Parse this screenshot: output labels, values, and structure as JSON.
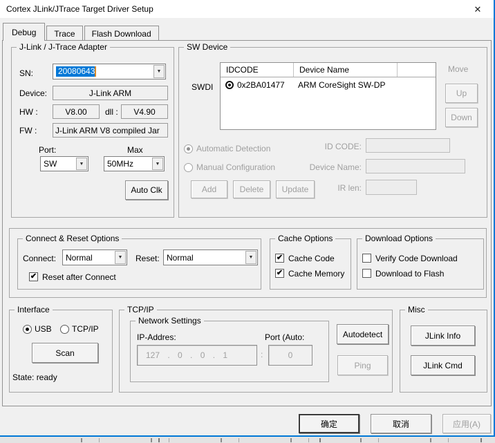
{
  "icons": {
    "close": "✕",
    "dropdown": "▼",
    "check": "✔"
  },
  "window": {
    "title": "Cortex JLink/JTrace Target Driver Setup"
  },
  "tabs": [
    {
      "label": "Debug",
      "active": true
    },
    {
      "label": "Trace",
      "active": false
    },
    {
      "label": "Flash Download",
      "active": false
    }
  ],
  "adapter": {
    "title": "J-Link / J-Trace Adapter",
    "sn_label": "SN:",
    "sn_value": "20080643",
    "device_label": "Device:",
    "device_value": "J-Link ARM",
    "hw_label": "HW :",
    "hw_value": "V8.00",
    "dll_label": "dll :",
    "dll_value": "V4.90",
    "fw_label": "FW :",
    "fw_value": "J-Link ARM V8 compiled Jar",
    "port_label": "Port:",
    "port_value": "SW",
    "max_label": "Max",
    "max_value": "50MHz",
    "auto_clk_label": "Auto Clk"
  },
  "sw_device": {
    "title": "SW Device",
    "swdio_label": "SWDI",
    "table": {
      "columns": [
        "IDCODE",
        "Device Name",
        ""
      ],
      "rows": [
        {
          "idcode": "0x2BA01477",
          "device_name": "ARM CoreSight SW-DP",
          "selected": true
        }
      ]
    },
    "move_label": "Move",
    "up_label": "Up",
    "down_label": "Down",
    "automatic_detection_label": "Automatic Detection",
    "automatic_detection_selected": true,
    "manual_configuration_label": "Manual Configuration",
    "add_label": "Add",
    "delete_label": "Delete",
    "update_label": "Update",
    "id_code_label": "ID CODE:",
    "id_code_value": "",
    "device_name_label": "Device Name:",
    "device_name_value": "",
    "ir_len_label": "IR len:",
    "ir_len_value": ""
  },
  "connect_reset": {
    "title": "Connect & Reset Options",
    "connect_label": "Connect:",
    "connect_value": "Normal",
    "reset_label": "Reset:",
    "reset_value": "Normal",
    "reset_after_connect_label": "Reset after Connect",
    "reset_after_connect_checked": true
  },
  "cache_options": {
    "title": "Cache Options",
    "items": [
      {
        "label": "Cache Code",
        "checked": true
      },
      {
        "label": "Cache Memory",
        "checked": true
      }
    ]
  },
  "download_options": {
    "title": "Download Options",
    "items": [
      {
        "label": "Verify Code Download",
        "checked": false
      },
      {
        "label": "Download to Flash",
        "checked": false
      }
    ]
  },
  "interface": {
    "title": "Interface",
    "usb_label": "USB",
    "usb_selected": true,
    "tcpip_label": "TCP/IP",
    "scan_label": "Scan",
    "state_text": "State: ready"
  },
  "tcpip": {
    "title": "TCP/IP",
    "network_title": "Network Settings",
    "ip_label": "IP-Addres:",
    "ip_value": "127 . 0 . 0 . 1",
    "colon": ":",
    "port_label": "Port (Auto:",
    "port_value": "0",
    "autodetect_label": "Autodetect",
    "ping_label": "Ping"
  },
  "misc": {
    "title": "Misc",
    "jlink_info_label": "JLink Info",
    "jlink_cmd_label": "JLink Cmd"
  },
  "footer": {
    "ok_label": "确定",
    "cancel_label": "取消",
    "apply_label": "应用(A)"
  },
  "colors": {
    "accent_border": "#0078d7",
    "selection_bg": "#0078d7",
    "disabled_text": "#9f9f9f"
  }
}
